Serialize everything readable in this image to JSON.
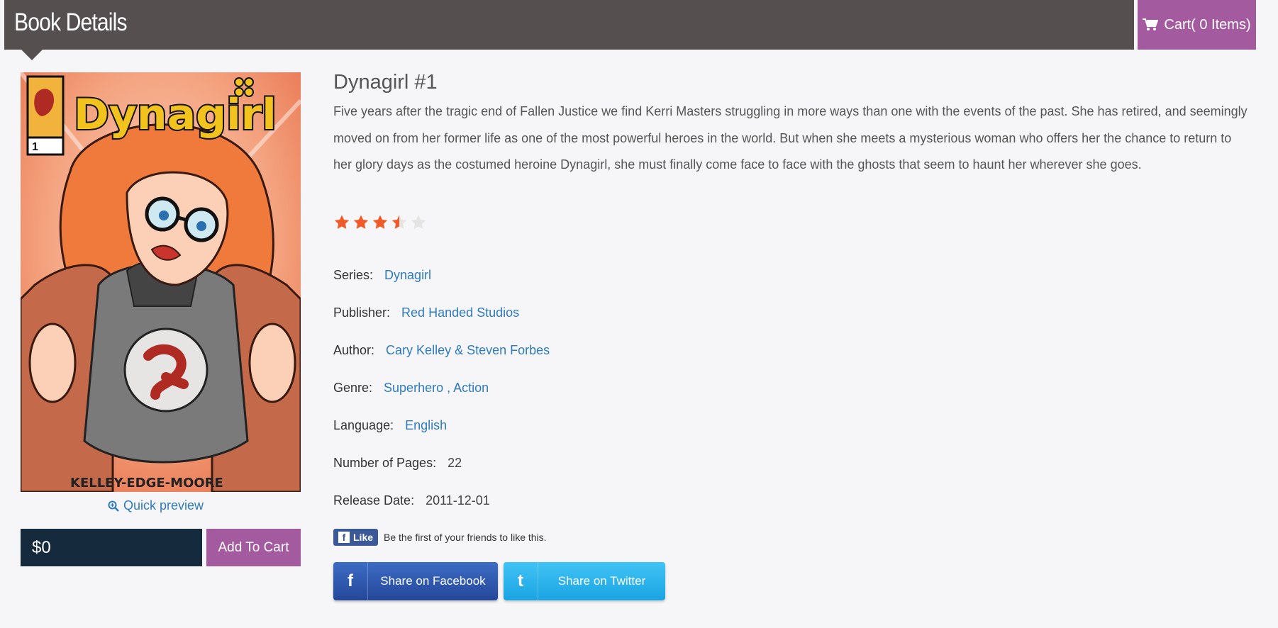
{
  "header": {
    "title": "Book Details",
    "cart_label": "Cart( 0 Items)"
  },
  "colors": {
    "header_bg": "#554f50",
    "accent": "#a35a9f",
    "link": "#2f7bbf",
    "price_bg": "#152a3d"
  },
  "cover": {
    "logo_text": "Dynagirl",
    "issue_number": "1",
    "credits": "KELLEY-EDGE-MOORE"
  },
  "quick_preview": "Quick preview",
  "price": "$0",
  "add_to_cart": "Add To Cart",
  "book": {
    "title": "Dynagirl #1",
    "description": "Five years after the tragic end of Fallen Justice we find Kerri Masters struggling in more ways than one with the events of the past. She has retired, and seemingly moved on from her former life as one of the most powerful heroes in the world. But when she meets a mysterious woman who offers her the chance to return to her glory days as the costumed heroine Dynagirl, she must finally come face to face with the ghosts that seem to haunt her wherever she goes.",
    "rating": 3.5,
    "rating_max": 5
  },
  "meta": {
    "series_label": "Series:",
    "series": "Dynagirl",
    "publisher_label": "Publisher:",
    "publisher": "Red Handed Studios",
    "author_label": "Author:",
    "author": "Cary Kelley & Steven Forbes",
    "genre_label": "Genre:",
    "genre_1": "Superhero",
    "genre_sep": ",",
    "genre_2": "Action",
    "language_label": "Language:",
    "language": "English",
    "pages_label": "Number of Pages:",
    "pages": "22",
    "release_label": "Release Date:",
    "release": "2011-12-01"
  },
  "social": {
    "like_label": "Like",
    "like_text": "Be the first of your friends to like this.",
    "share_facebook": "Share on Facebook",
    "share_twitter": "Share on Twitter",
    "facebook_icon": "facebook-icon",
    "twitter_icon": "twitter-icon"
  }
}
